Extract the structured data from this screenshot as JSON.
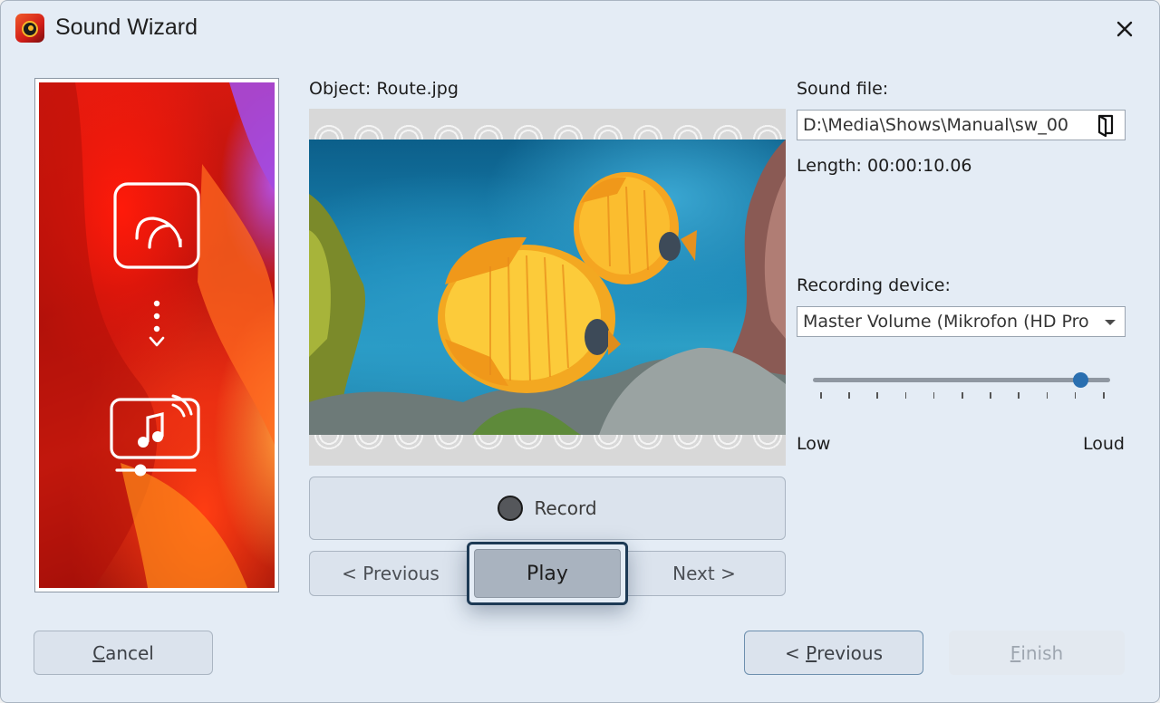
{
  "window": {
    "title": "Sound Wizard",
    "app_icon": "aquasoft-app-icon",
    "close_icon": "close-icon"
  },
  "object_label": "Object: Route.jpg",
  "preview": {
    "image_name": "Route.jpg"
  },
  "controls": {
    "record_label": "Record",
    "record_icon": "record-dot-icon",
    "previous_label": "< Previous",
    "play_label": "Play",
    "next_label": "Next >"
  },
  "sound": {
    "label": "Sound file:",
    "path": "D:\\Media\\Shows\\Manual\\sw_00",
    "folder_icon": "open-folder-icon",
    "length": "Length: 00:00:10.06"
  },
  "recording": {
    "label": "Recording device:",
    "device": "Master Volume (Mikrofon (HD Pro",
    "volume_fraction": 0.9,
    "low_label": "Low",
    "loud_label": "Loud"
  },
  "footer": {
    "cancel_underline": "C",
    "cancel_rest": "ancel",
    "previous_prefix": "< ",
    "previous_underline": "P",
    "previous_rest": "revious",
    "finish_underline": "F",
    "finish_rest": "inish"
  },
  "colors": {
    "accent": "#2a6fb0",
    "focus_border": "#1d3a55",
    "dialog_bg": "#e4ecf5"
  }
}
